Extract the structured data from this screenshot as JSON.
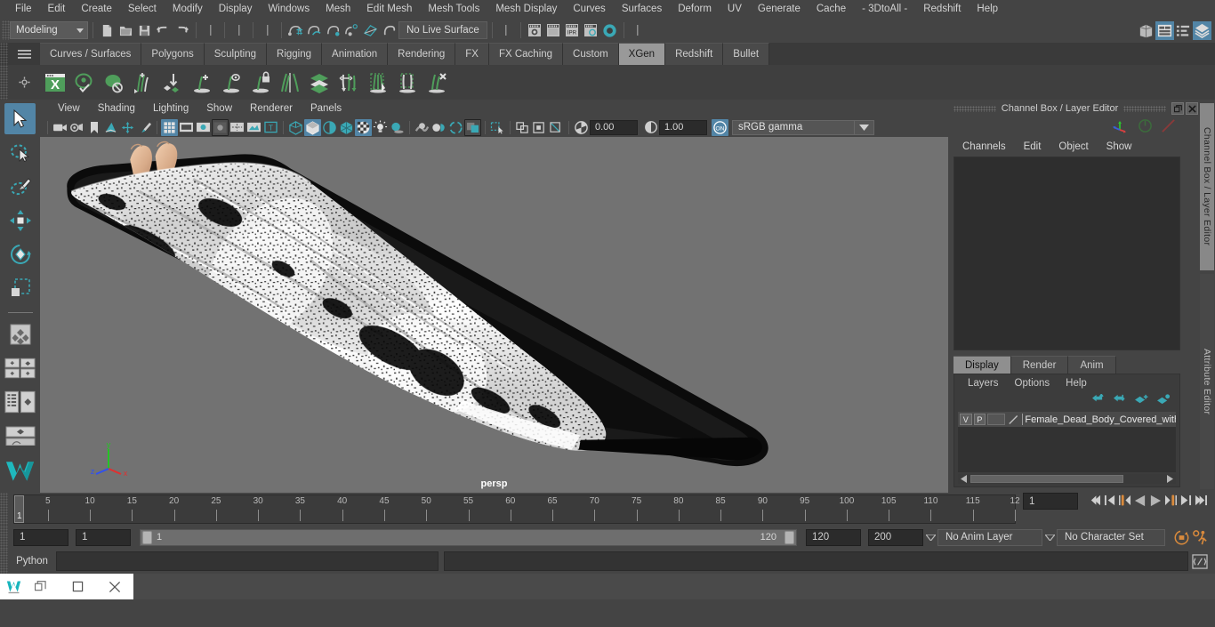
{
  "app": {
    "title": "Autodesk Maya"
  },
  "menubar": {
    "items": [
      "File",
      "Edit",
      "Create",
      "Select",
      "Modify",
      "Display",
      "Windows",
      "Mesh",
      "Edit Mesh",
      "Mesh Tools",
      "Mesh Display",
      "Curves",
      "Surfaces",
      "Deform",
      "UV",
      "Generate",
      "Cache",
      "- 3DtoAll -",
      "Redshift",
      "Help"
    ]
  },
  "statusbar": {
    "mode": "Modeling",
    "live_surface": "No Live Surface",
    "icons": [
      "new-scene-icon",
      "open-scene-icon",
      "save-scene-icon",
      "undo-icon",
      "redo-icon",
      "select-by-hierarchy-icon",
      "select-by-object-icon",
      "select-by-component-icon",
      "snap-to-grid-icon",
      "snap-to-curve-icon",
      "snap-to-point-icon",
      "snap-to-projected-center-icon",
      "snap-to-view-plane-icon",
      "make-live-icon",
      "render-view-icon",
      "render-current-frame-icon",
      "ipr-render-icon",
      "render-settings-icon",
      "hypershade-icon"
    ],
    "right_icons": [
      "show-hide-editors-icon",
      "attribute-editor-toggle-icon",
      "tool-settings-toggle-icon",
      "channel-box-toggle-icon"
    ]
  },
  "shelf": {
    "tabs": [
      "Curves / Surfaces",
      "Polygons",
      "Sculpting",
      "Rigging",
      "Animation",
      "Rendering",
      "FX",
      "FX Caching",
      "Custom",
      "XGen",
      "Redshift",
      "Bullet"
    ],
    "active_tab": "XGen",
    "icons": [
      "xgen-editor-icon",
      "xgen-preview-icon",
      "xgen-disable-preview-icon",
      "xgen-add-guides-icon",
      "xgen-place-guide-icon",
      "xgen-grow-icon",
      "xgen-select-guide-icon",
      "xgen-lock-guide-icon",
      "xgen-mirror-guides-icon",
      "xgen-density-map-icon",
      "xgen-part-hair-icon",
      "xgen-clump-icon",
      "xgen-region-icon",
      "xgen-delete-guide-icon"
    ]
  },
  "toolbox": {
    "tools": [
      "select-tool",
      "lasso-select-tool",
      "paint-select-tool",
      "move-tool",
      "rotate-tool",
      "scale-tool"
    ],
    "layouts": [
      "single-perspective-layout",
      "four-view-layout",
      "outliner-persp-layout",
      "hypergraph-persp-layout"
    ],
    "selected": "select-tool"
  },
  "viewport": {
    "menu": [
      "View",
      "Shading",
      "Lighting",
      "Show",
      "Renderer",
      "Panels"
    ],
    "camera_label": "persp",
    "exposure": "0.00",
    "gamma": "1.00",
    "color_space": "sRGB gamma",
    "axis": {
      "x": "x",
      "y": "y",
      "z": "z"
    },
    "toolbar_icons": [
      "select-camera-icon",
      "camera-attributes-icon",
      "bookmark-icon",
      "image-plane-icon",
      "two-d-pan-zoom-icon",
      "grease-pencil-icon",
      "grid-toggle-icon",
      "film-gate-icon",
      "resolution-gate-icon",
      "gate-mask-icon",
      "film-origin-icon",
      "safe-action-icon",
      "xray-text-icon",
      "wireframe-icon",
      "smooth-shade-icon",
      "shade-wireframe-icon",
      "use-default-material-icon",
      "textured-icon",
      "use-all-lights-icon",
      "shadows-icon",
      "screen-space-ao-icon",
      "motion-blur-icon",
      "multisample-icon",
      "isolate-select-icon",
      "xray-icon",
      "xray-joints-icon",
      "xray-active-components-icon",
      "exposure-icon",
      "gamma-icon",
      "color-management-icon"
    ],
    "object_name": "Female_Dead_Body_Covered_with_Cloth"
  },
  "channelbox": {
    "title": "Channel Box / Layer Editor",
    "menu": [
      "Channels",
      "Edit",
      "Object",
      "Show"
    ],
    "icons": [
      "transform-channels-icon",
      "output-channels-icon",
      "shape-channels-icon"
    ],
    "window_buttons": [
      "undock-icon",
      "close-icon"
    ],
    "vertical_tabs": [
      "Channel Box / Layer Editor",
      "Attribute Editor"
    ]
  },
  "layers": {
    "tabs": [
      "Display",
      "Render",
      "Anim"
    ],
    "active_tab": "Display",
    "menu": [
      "Layers",
      "Options",
      "Help"
    ],
    "buttons": [
      "move-layer-up-icon",
      "move-layer-down-icon",
      "new-layer-icon",
      "new-layer-from-selected-icon"
    ],
    "rows": [
      {
        "visibility": "V",
        "playback": "P",
        "shading": "",
        "color_swatch": "#a0a0a0",
        "name": "Female_Dead_Body_Covered_with_Cl"
      }
    ]
  },
  "timeline": {
    "start": 1,
    "end": 120,
    "current_frame": "1",
    "ticks": [
      5,
      10,
      15,
      20,
      25,
      30,
      35,
      40,
      45,
      50,
      55,
      60,
      65,
      70,
      75,
      80,
      85,
      90,
      95,
      100,
      105,
      110,
      115,
      120
    ],
    "tick_label_last": "12",
    "playback_buttons": [
      "go-to-start-icon",
      "step-back-keyframe-icon",
      "step-back-frame-icon",
      "play-backwards-icon",
      "play-forwards-icon",
      "step-forward-frame-icon",
      "step-forward-keyframe-icon",
      "go-to-end-icon"
    ]
  },
  "rangeslider": {
    "anim_start": "1",
    "range_start": "1",
    "bar_start_label": "1",
    "bar_end_label": "120",
    "range_end": "120",
    "anim_end": "200",
    "anim_layer": "No Anim Layer",
    "character_set": "No Character Set",
    "right_icons": [
      "auto-key-icon",
      "animation-preferences-icon"
    ]
  },
  "commandline": {
    "language": "Python",
    "input_value": "",
    "result_value": "",
    "script_editor_icon": "script-editor-icon"
  },
  "taskbar": {
    "window_buttons": [
      "restore-icon",
      "maximize-icon",
      "close-icon"
    ],
    "app_icon": "maya-app-icon"
  },
  "colors": {
    "accent": "#5285a6",
    "shelf_active": "#999999",
    "xgen_green": "#4f9e5b",
    "teal": "#3aa8b5",
    "orange": "#d98a3c"
  }
}
